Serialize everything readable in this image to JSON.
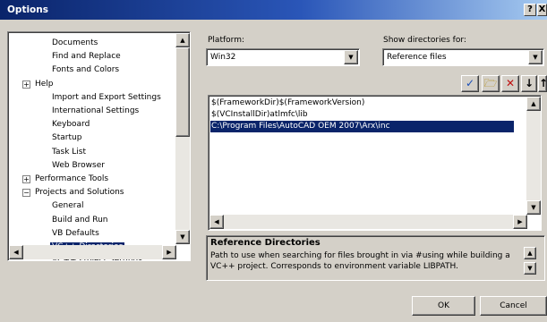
{
  "window": {
    "title": "Options",
    "help_label": "?",
    "close_label": "X"
  },
  "tree": {
    "items": [
      {
        "label": "Documents",
        "selected": false
      },
      {
        "label": "Find and Replace",
        "selected": false
      },
      {
        "label": "Fonts and Colors",
        "selected": false
      },
      {
        "label": "Help",
        "expander": "+",
        "selected": false
      },
      {
        "label": "Import and Export Settings",
        "selected": false
      },
      {
        "label": "International Settings",
        "selected": false
      },
      {
        "label": "Keyboard",
        "selected": false
      },
      {
        "label": "Startup",
        "selected": false
      },
      {
        "label": "Task List",
        "selected": false
      },
      {
        "label": "Web Browser",
        "selected": false
      },
      {
        "label": "Performance Tools",
        "expander": "+",
        "selected": false
      },
      {
        "label": "Projects and Solutions",
        "expander": "−",
        "selected": false
      },
      {
        "label": "General",
        "selected": false
      },
      {
        "label": "Build and Run",
        "selected": false
      },
      {
        "label": "VB Defaults",
        "selected": false
      },
      {
        "label": "VC++ Directories",
        "selected": true
      },
      {
        "label": "VC++ Project Settings",
        "selected": false
      }
    ]
  },
  "platform": {
    "label": "Platform:",
    "value": "Win32"
  },
  "show_dirs": {
    "label": "Show directories for:",
    "value": "Reference files"
  },
  "toolbar": {
    "check": "✓",
    "new_folder": "🗁",
    "delete": "✕",
    "down": "↓",
    "up": "↑"
  },
  "directories": [
    {
      "path": "$(FrameworkDir)$(FrameworkVersion)",
      "selected": false
    },
    {
      "path": "$(VCInstallDir)atlmfc\\lib",
      "selected": false
    },
    {
      "path": "C:\\Program Files\\AutoCAD OEM 2007\\Arx\\inc",
      "selected": true
    }
  ],
  "description": {
    "title": "Reference Directories",
    "line1": "Path to use when searching for files brought in via #using while building a",
    "line2": "VC++ project.  Corresponds to environment variable LIBPATH."
  },
  "buttons": {
    "ok": "OK",
    "cancel": "Cancel"
  },
  "colors": {
    "selection": "#0a246a",
    "face": "#d4d0c8",
    "title_start": "#0a246a",
    "title_end": "#a6caf0"
  }
}
